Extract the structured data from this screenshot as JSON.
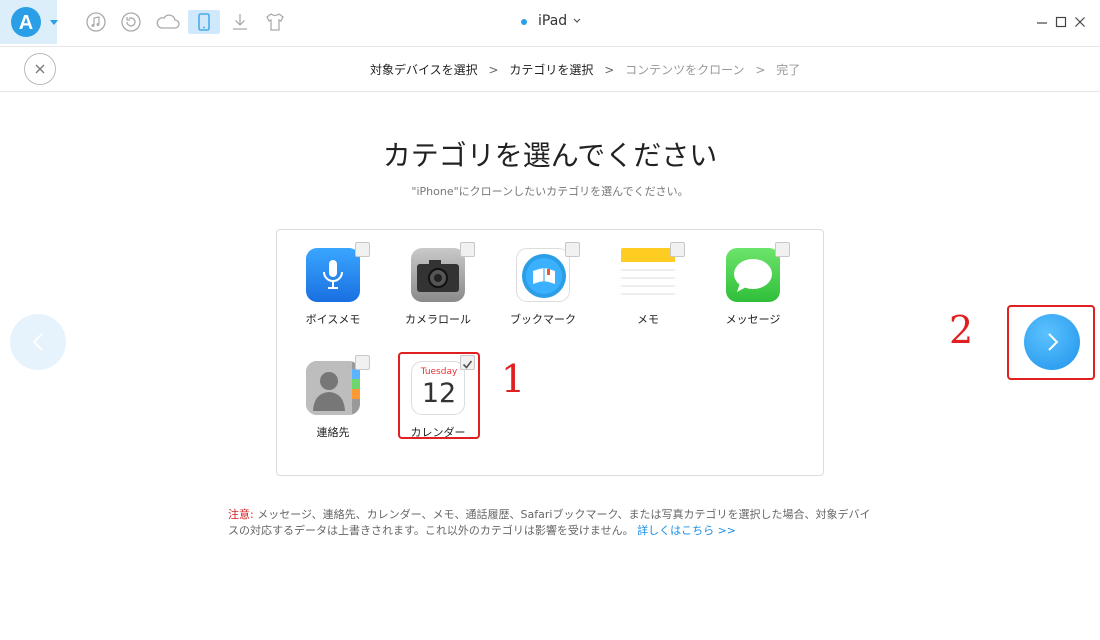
{
  "app": {
    "device_name": "iPad"
  },
  "breadcrumb": {
    "step1": "対象デバイスを選択",
    "step2": "カテゴリを選択",
    "step3": "コンテンツをクローン",
    "step4": "完了",
    "separator": ">"
  },
  "main": {
    "title": "カテゴリを選んでください",
    "subtitle": "\"iPhone\"にクローンしたいカテゴリを選んでください。"
  },
  "categories": [
    {
      "label": "ボイスメモ",
      "icon": "voice-memo-icon",
      "checked": false
    },
    {
      "label": "カメラロール",
      "icon": "camera-icon",
      "checked": false
    },
    {
      "label": "ブックマーク",
      "icon": "safari-icon",
      "checked": false
    },
    {
      "label": "メモ",
      "icon": "notes-icon",
      "checked": false
    },
    {
      "label": "メッセージ",
      "icon": "messages-icon",
      "checked": false
    },
    {
      "label": "連絡先",
      "icon": "contacts-icon",
      "checked": false
    },
    {
      "label": "カレンダー",
      "icon": "calendar-icon",
      "checked": true
    }
  ],
  "calendar_icon": {
    "weekday": "Tuesday",
    "day": "12"
  },
  "annotations": {
    "marker1": "1",
    "marker2": "2"
  },
  "note": {
    "label": "注意:",
    "text": " メッセージ、連絡先、カレンダー、メモ、通話履歴、Safariブックマーク、または写真カテゴリを選択した場合、対象デバイスの対応するデータは上書きされます。これ以外のカテゴリは影響を受けません。",
    "link": "詳しくはこちら >>"
  },
  "colors": {
    "accent": "#2b9ee8",
    "annotation_red": "#e02020",
    "warning_red": "#d42020"
  }
}
